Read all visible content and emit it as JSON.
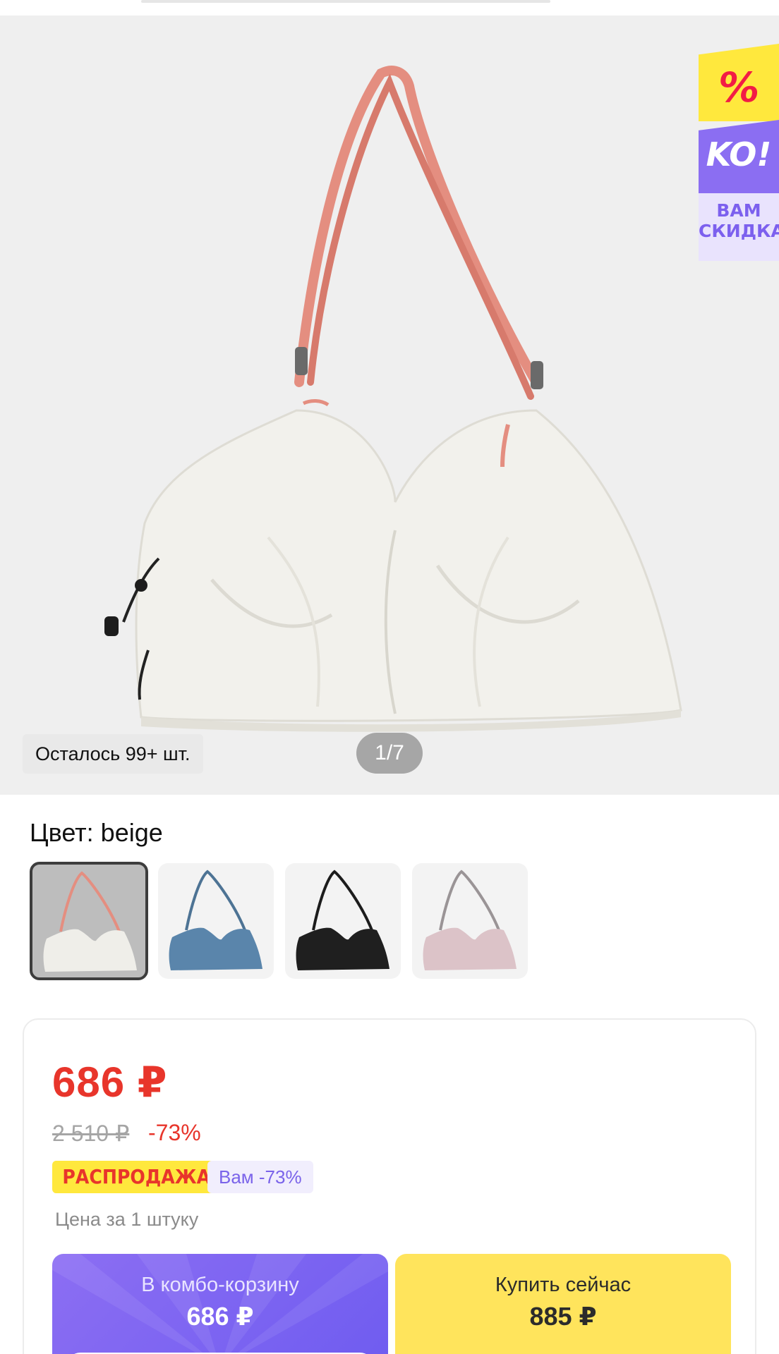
{
  "gallery": {
    "stock_label": "Осталось 99+ шт.",
    "counter": "1/7",
    "promo": {
      "symbol": "%",
      "brand": "KO!",
      "line1": "ВАМ",
      "line2": "СКИДКА"
    }
  },
  "color": {
    "label": "Цвет: beige",
    "options": [
      "beige",
      "blue",
      "black",
      "pink"
    ],
    "selected": "beige"
  },
  "price": {
    "current": "686 ₽",
    "old": "2 510 ₽",
    "discount": "-73%",
    "badge_sale": "РАСПРОДАЖА",
    "badge_you": "Вам -73%",
    "per_unit": "Цена за 1 штуку"
  },
  "actions": {
    "combo": {
      "label": "В комбо-корзину",
      "price": "686 ₽"
    },
    "buy": {
      "label": "Купить сейчас",
      "price": "885 ₽"
    }
  },
  "colors": {
    "accent_red": "#e8352b",
    "accent_purple": "#7a63ea",
    "buy_yellow": "#ffe45c"
  }
}
